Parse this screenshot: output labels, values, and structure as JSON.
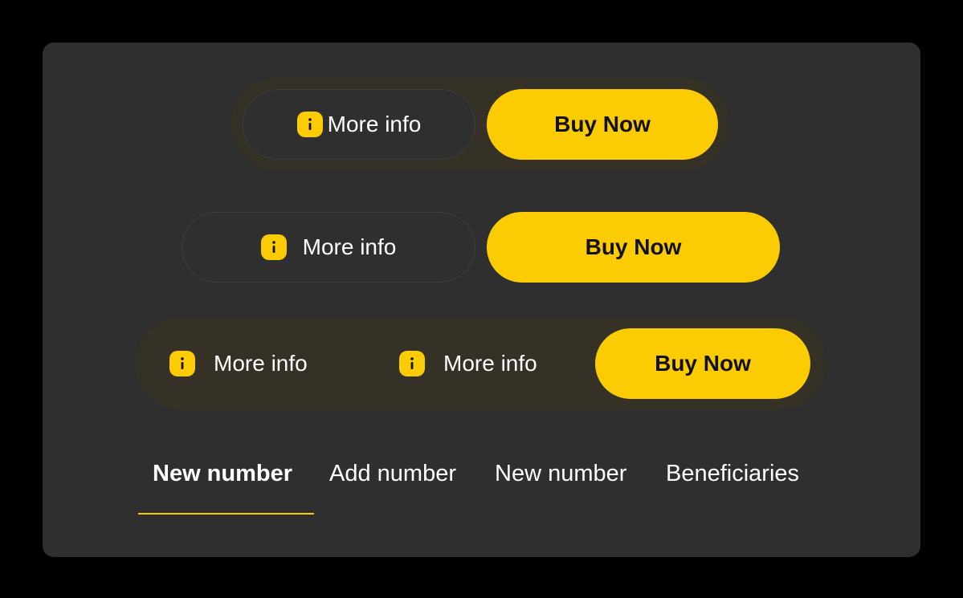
{
  "colors": {
    "accent": "#fbcb04",
    "card_background": "#2f2f2f",
    "page_background": "#000000",
    "group_background": "#363126"
  },
  "row1": {
    "more_info_label": "More info",
    "more_info_icon": "info-icon",
    "buy_label": "Buy Now"
  },
  "row2": {
    "more_info_label": "More info",
    "more_info_icon": "info-icon",
    "buy_label": "Buy Now"
  },
  "row3": {
    "more_info_1_label": "More info",
    "more_info_2_label": "More info",
    "more_info_icon": "info-icon",
    "buy_label": "Buy Now"
  },
  "tabs": [
    {
      "label": "New number",
      "active": true
    },
    {
      "label": "Add number",
      "active": false
    },
    {
      "label": "New number",
      "active": false
    },
    {
      "label": "Beneficiaries",
      "active": false
    }
  ]
}
